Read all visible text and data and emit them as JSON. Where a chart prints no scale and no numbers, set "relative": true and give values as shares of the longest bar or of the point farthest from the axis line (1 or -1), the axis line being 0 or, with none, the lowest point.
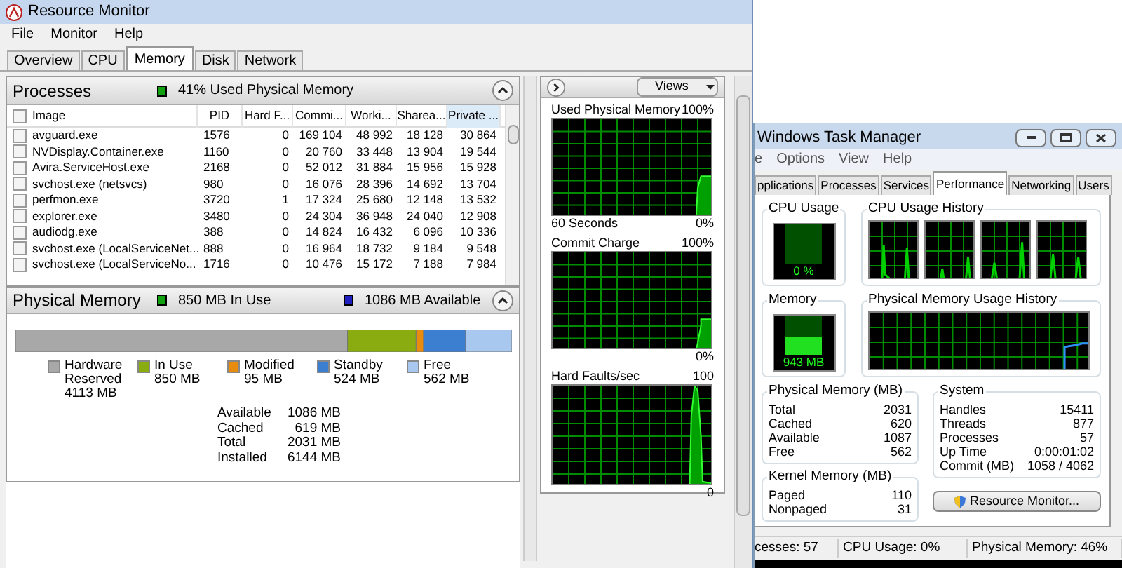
{
  "resmon": {
    "title": "Resource Monitor",
    "menu": [
      "File",
      "Monitor",
      "Help"
    ],
    "tabs": [
      {
        "label": "Overview",
        "selected": false
      },
      {
        "label": "CPU",
        "selected": false
      },
      {
        "label": "Memory",
        "selected": true
      },
      {
        "label": "Disk",
        "selected": false
      },
      {
        "label": "Network",
        "selected": false
      }
    ],
    "processes": {
      "title": "Processes",
      "summary": "41% Used Physical Memory",
      "all_checked": false,
      "columns": [
        {
          "label": "Image",
          "sorted": false
        },
        {
          "label": "PID",
          "sorted": false
        },
        {
          "label": "Hard F...",
          "sorted": false
        },
        {
          "label": "Commi...",
          "sorted": false
        },
        {
          "label": "Worki...",
          "sorted": false
        },
        {
          "label": "Sharea...",
          "sorted": false
        },
        {
          "label": "Private ...",
          "sorted": true
        }
      ],
      "rows": [
        {
          "checked": false,
          "cells": [
            "avguard.exe",
            "1576",
            "0",
            "169 104",
            "48 992",
            "18 128",
            "30 864"
          ]
        },
        {
          "checked": false,
          "cells": [
            "NVDisplay.Container.exe",
            "1160",
            "0",
            "20 760",
            "33 448",
            "13 904",
            "19 544"
          ]
        },
        {
          "checked": false,
          "cells": [
            "Avira.ServiceHost.exe",
            "2168",
            "0",
            "52 012",
            "31 884",
            "15 956",
            "15 928"
          ]
        },
        {
          "checked": false,
          "cells": [
            "svchost.exe (netsvcs)",
            "980",
            "0",
            "16 076",
            "28 396",
            "14 692",
            "13 704"
          ]
        },
        {
          "checked": false,
          "cells": [
            "perfmon.exe",
            "3720",
            "1",
            "17 324",
            "25 680",
            "12 148",
            "13 532"
          ]
        },
        {
          "checked": false,
          "cells": [
            "explorer.exe",
            "3480",
            "0",
            "24 304",
            "36 948",
            "24 040",
            "12 908"
          ]
        },
        {
          "checked": false,
          "cells": [
            "audiodg.exe",
            "388",
            "0",
            "14 824",
            "16 432",
            "6 096",
            "10 336"
          ]
        },
        {
          "checked": false,
          "cells": [
            "svchost.exe (LocalServiceNet...",
            "888",
            "0",
            "16 964",
            "18 732",
            "9 184",
            "9 548"
          ]
        },
        {
          "checked": false,
          "cells": [
            "svchost.exe (LocalServiceNo...",
            "1716",
            "0",
            "10 476",
            "15 172",
            "7 188",
            "7 984"
          ]
        }
      ]
    },
    "physical_memory": {
      "title": "Physical Memory",
      "in_use": "850 MB In Use",
      "available": "1086 MB Available",
      "legend_values": [
        "4113 MB",
        "850 MB",
        "95 MB",
        "524 MB",
        "562 MB"
      ],
      "chart_data": {
        "type": "bar",
        "orientation": "horizontal",
        "stacked": true,
        "relative": true,
        "legend": "bottom",
        "series": [
          {
            "name": "Hardware Reserved",
            "color": "#a8a8a8",
            "values": [
              0.669
            ]
          },
          {
            "name": "In Use",
            "color": "#8aac10",
            "values": [
              0.138
            ]
          },
          {
            "name": "Modified",
            "color": "#e88c10",
            "values": [
              0.015
            ]
          },
          {
            "name": "Standby",
            "color": "#3c7fd0",
            "values": [
              0.085
            ]
          },
          {
            "name": "Free",
            "color": "#a8c8f0",
            "values": [
              0.093
            ]
          }
        ]
      },
      "stats": [
        {
          "label": "Available",
          "value": "1086 MB"
        },
        {
          "label": "Cached",
          "value": "619 MB"
        },
        {
          "label": "Total",
          "value": "2031 MB"
        },
        {
          "label": "Installed",
          "value": "6144 MB"
        }
      ]
    },
    "graphs_panel": {
      "views_button": "Views",
      "graphs": [
        {
          "title": "Used Physical Memory",
          "max": "100%",
          "min": "0%",
          "time": "60 Seconds"
        },
        {
          "title": "Commit Charge",
          "max": "100%",
          "min": "0%"
        },
        {
          "title": "Hard Faults/sec",
          "max": "100",
          "min": "0"
        }
      ]
    }
  },
  "task_manager": {
    "title": "Windows Task Manager",
    "menu": [
      "e",
      "Options",
      "View",
      "Help"
    ],
    "tabs": [
      {
        "label": "pplications",
        "selected": false
      },
      {
        "label": "Processes",
        "selected": false
      },
      {
        "label": "Services",
        "selected": false
      },
      {
        "label": "Performance",
        "selected": true
      },
      {
        "label": "Networking",
        "selected": false
      },
      {
        "label": "Users",
        "selected": false
      }
    ],
    "cpu_usage": {
      "title": "CPU Usage",
      "reading": "0 %"
    },
    "cpu_history": {
      "title": "CPU Usage History"
    },
    "memory": {
      "title": "Memory",
      "reading": "943 MB",
      "level": 0.46
    },
    "memory_history": {
      "title": "Physical Memory Usage History"
    },
    "physical_memory": {
      "title": "Physical Memory (MB)",
      "rows": [
        {
          "label": "Total",
          "value": "2031"
        },
        {
          "label": "Cached",
          "value": "620"
        },
        {
          "label": "Available",
          "value": "1087"
        },
        {
          "label": "Free",
          "value": "562"
        }
      ]
    },
    "kernel_memory": {
      "title": "Kernel Memory (MB)",
      "rows": [
        {
          "label": "Paged",
          "value": "110"
        },
        {
          "label": "Nonpaged",
          "value": "31"
        }
      ]
    },
    "system": {
      "title": "System",
      "rows": [
        {
          "label": "Handles",
          "value": "15411"
        },
        {
          "label": "Threads",
          "value": "877"
        },
        {
          "label": "Processes",
          "value": "57"
        },
        {
          "label": "Up Time",
          "value": "0:00:01:02"
        },
        {
          "label": "Commit (MB)",
          "value": "1058 / 4062"
        }
      ]
    },
    "resource_monitor_button": "Resource Monitor...",
    "status_bar": [
      "cesses: 57",
      "CPU Usage: 0%",
      "Physical Memory: 46%"
    ]
  }
}
